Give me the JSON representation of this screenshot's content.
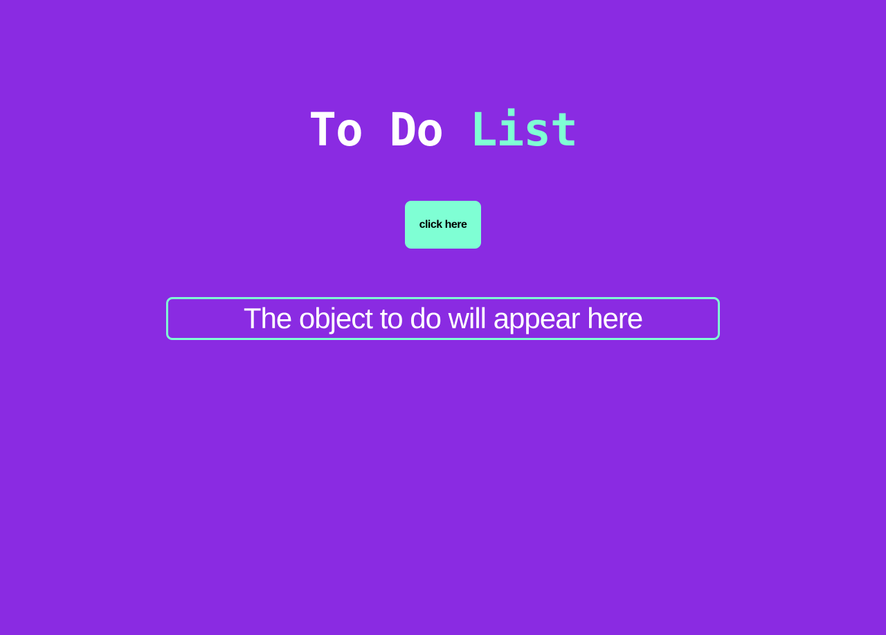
{
  "header": {
    "title_part1": "To Do",
    "title_part2": "List"
  },
  "action": {
    "button_label": "click here"
  },
  "todo": {
    "placeholder_text": "The object to do will appear here"
  },
  "colors": {
    "background": "#8A2BE2",
    "accent": "#7FFFD4",
    "text": "#FFFFFF"
  }
}
